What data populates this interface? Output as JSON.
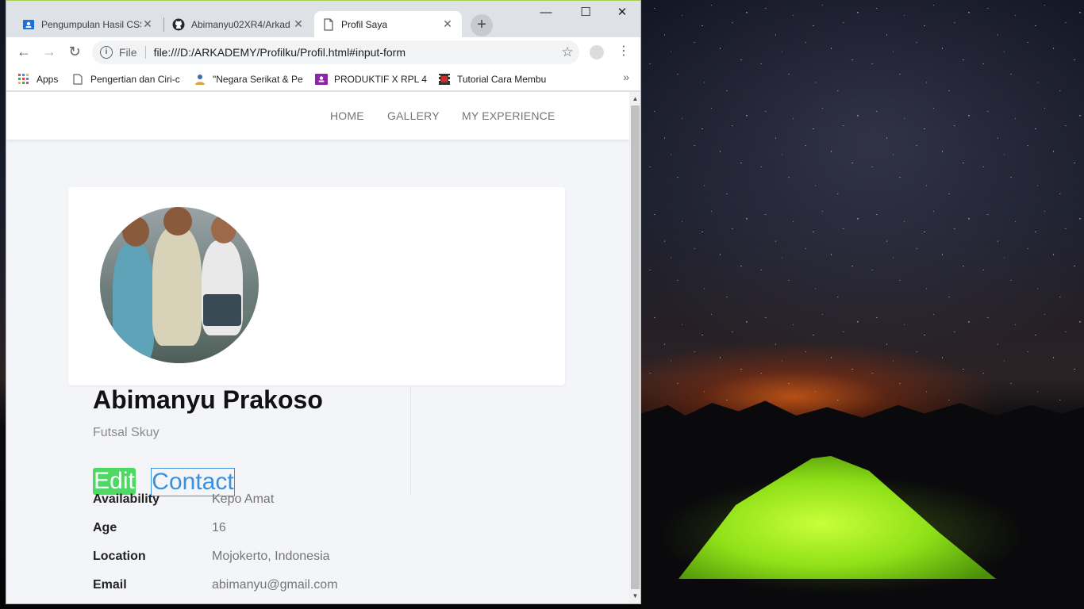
{
  "browser": {
    "tabs": [
      {
        "title": "Pengumpulan Hasil CSS",
        "active": false,
        "icon": "classroom-icon"
      },
      {
        "title": "Abimanyu02XR4/Arkad",
        "active": false,
        "icon": "github-icon"
      },
      {
        "title": "Profil Saya",
        "active": true,
        "icon": "page-icon"
      }
    ],
    "new_tab": "+",
    "window_controls": {
      "minimize": "—",
      "maximize": "☐",
      "close": "✕"
    },
    "address": {
      "scheme_label": "File",
      "url": "file:///D:/ARKADEMY/Profilku/Profil.html#input-form"
    },
    "bookmarks": [
      {
        "label": "Apps",
        "icon": "apps-grid-icon"
      },
      {
        "label": "Pengertian dan Ciri-c",
        "icon": "page-icon"
      },
      {
        "label": "\"Negara Serikat & Pe",
        "icon": "person-icon"
      },
      {
        "label": "PRODUKTIF X RPL 4 -",
        "icon": "classroom-icon"
      },
      {
        "label": "Tutorial Cara Membu",
        "icon": "film-icon"
      }
    ],
    "bookmarks_more": "»"
  },
  "site": {
    "nav": [
      "HOME",
      "GALLERY",
      "MY EXPERIENCE"
    ],
    "profile": {
      "name": "Abimanyu Prakoso",
      "tagline": "Futsal Skuy",
      "edit_label": "Edit",
      "contact_label": "Contact",
      "details": [
        {
          "label": "Availability",
          "value": "Kepo Amat"
        },
        {
          "label": "Age",
          "value": "16"
        },
        {
          "label": "Location",
          "value": "Mojokerto, Indonesia"
        },
        {
          "label": "Email",
          "value": "abimanyu@gmail.com"
        }
      ]
    }
  },
  "colors": {
    "edit_button": "#4cd964",
    "contact_button": "#3b8fdf",
    "page_background": "#f4f5f9",
    "window_border": "#a6cf52"
  }
}
